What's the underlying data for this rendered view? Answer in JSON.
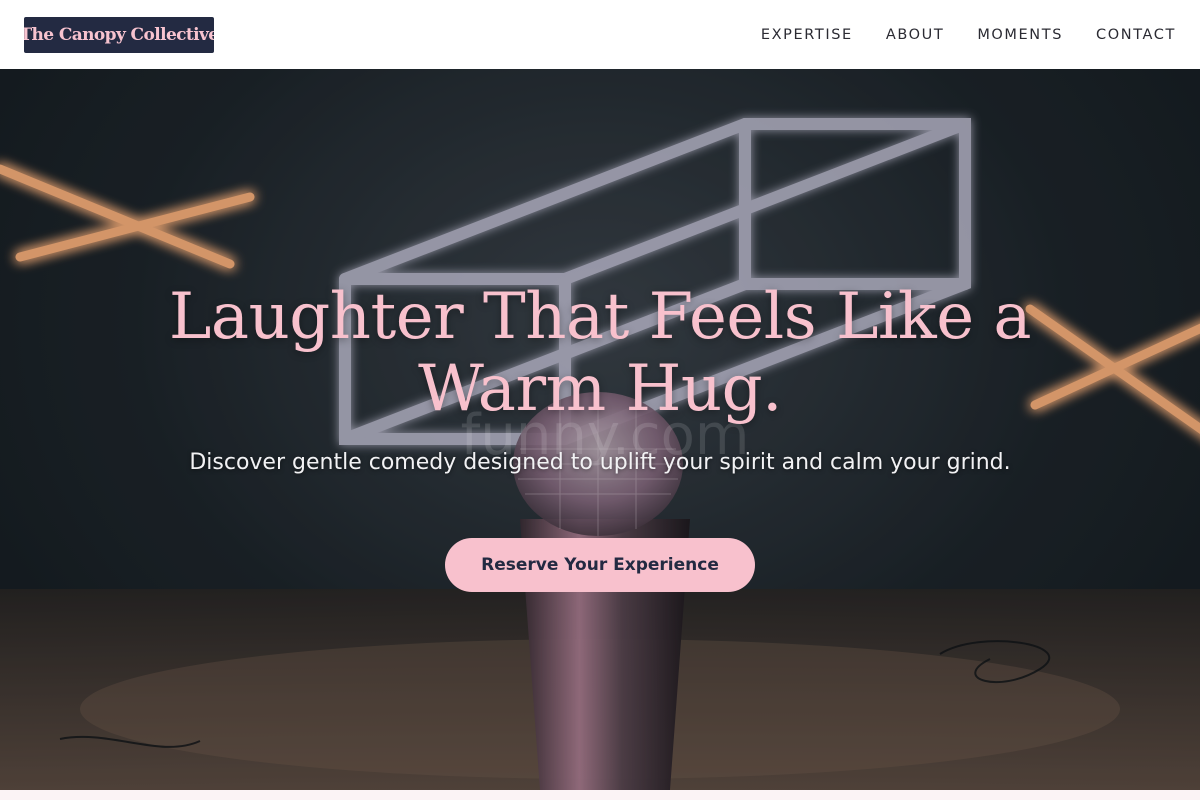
{
  "header": {
    "logo_text": "The Canopy Collective",
    "nav": [
      {
        "label": "EXPERTISE"
      },
      {
        "label": "ABOUT"
      },
      {
        "label": "MOMENTS"
      },
      {
        "label": "CONTACT"
      }
    ]
  },
  "hero": {
    "title": "Laughter That Feels Like a Warm Hug.",
    "subtitle": "Discover gentle comedy designed to uplift your spirit and calm your grind.",
    "cta_label": "Reserve Your Experience",
    "background_image": "stage-microphone-neon-image",
    "watermark": "funny.com"
  },
  "colors": {
    "accent_pink": "#f8c1cd",
    "navy": "#232a42",
    "neon_orange": "#ff9a4a",
    "neon_white": "#d9d6ea"
  }
}
